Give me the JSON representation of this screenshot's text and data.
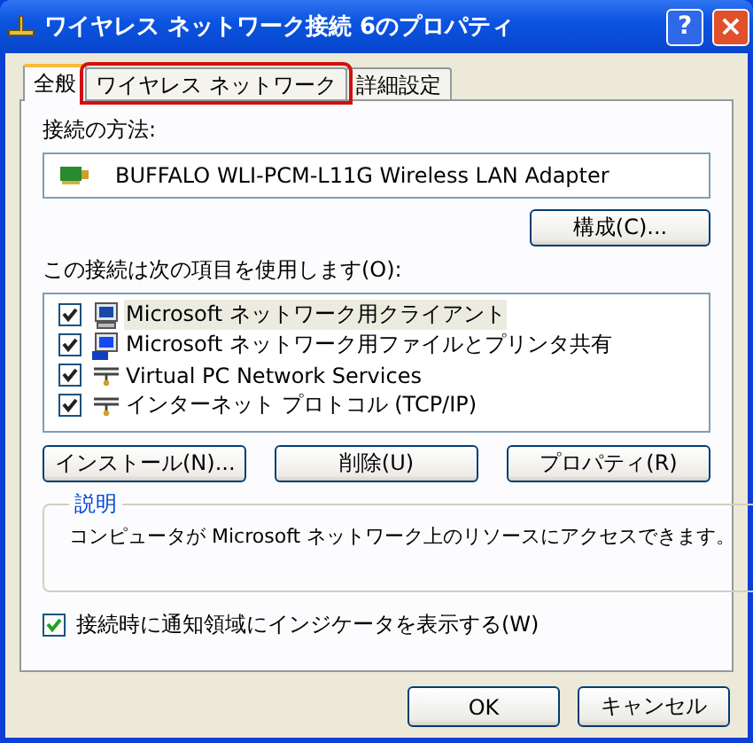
{
  "window": {
    "title": "ワイヤレス ネットワーク接続 6のプロパティ",
    "buttons": [
      {
        "kind": "help",
        "label": "?"
      },
      {
        "kind": "close",
        "label": "×"
      }
    ]
  },
  "tabs": [
    {
      "label": "全般",
      "selected": true,
      "highlighted": false
    },
    {
      "label": "ワイヤレス ネットワーク",
      "selected": false,
      "highlighted": true
    },
    {
      "label": "詳細設定",
      "selected": false,
      "highlighted": false
    }
  ],
  "connect_using": {
    "label": "接続の方法:",
    "adapter": "BUFFALO WLI-PCM-L11G Wireless LAN Adapter",
    "configure_button": "構成(C)..."
  },
  "components": {
    "label": "この接続は次の項目を使用します(O):",
    "items": [
      {
        "kind": "client",
        "label": "Microsoft ネットワーク用クライアント",
        "checked": true,
        "selected": true
      },
      {
        "kind": "service",
        "label": "Microsoft ネットワーク用ファイルとプリンタ共有",
        "checked": true,
        "selected": false
      },
      {
        "kind": "protocol",
        "label": "Virtual PC Network Services",
        "checked": true,
        "selected": false
      },
      {
        "kind": "protocol",
        "label": "インターネット プロトコル (TCP/IP)",
        "checked": true,
        "selected": false
      }
    ],
    "buttons": [
      "インストール(N)...",
      "削除(U)",
      "プロパティ(R)"
    ]
  },
  "description": {
    "label": "説明",
    "text": "コンピュータが Microsoft ネットワーク上のリソースにアクセスできます。"
  },
  "show_icon": {
    "label": "接続時に通知領域にインジケータを表示する(W)",
    "checked": true
  },
  "dialog_buttons": [
    "OK",
    "キャンセル"
  ]
}
